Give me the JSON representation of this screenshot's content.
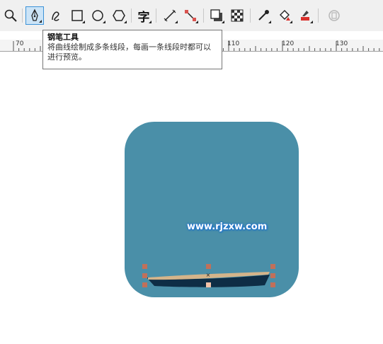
{
  "toolbar": {
    "tools": [
      {
        "icon": "zoom-icon"
      },
      {
        "icon": "pen-tool-icon",
        "active": true
      },
      {
        "icon": "curve-tool-icon"
      },
      {
        "icon": "rectangle-tool-icon"
      },
      {
        "icon": "ellipse-tool-icon"
      },
      {
        "icon": "polygon-tool-icon"
      },
      {
        "icon": "text-tool-icon",
        "glyph": "字"
      },
      {
        "icon": "dimension-tool-icon"
      },
      {
        "icon": "connector-tool-icon"
      },
      {
        "icon": "drop-shadow-tool-icon"
      },
      {
        "icon": "transparency-tool-icon"
      },
      {
        "icon": "eyedropper-tool-icon"
      },
      {
        "icon": "interactive-fill-icon"
      },
      {
        "icon": "smart-fill-icon"
      },
      {
        "icon": "disabled-tool-icon"
      }
    ]
  },
  "tooltip": {
    "title": "钢笔工具",
    "description": "将曲线绘制成多条线段，每画一条线段时都可以进行预览。"
  },
  "ruler": {
    "labels": [
      "70",
      "110",
      "120",
      "130"
    ]
  },
  "canvas": {
    "watermark": "www.rjzxw.com"
  },
  "colors": {
    "logo_background": "#4a8fa8",
    "boat_hull": "#0e2d45",
    "boat_deck": "#d4b48a",
    "node_marker": "#c0705a",
    "active_tool": "#cce4f7"
  }
}
